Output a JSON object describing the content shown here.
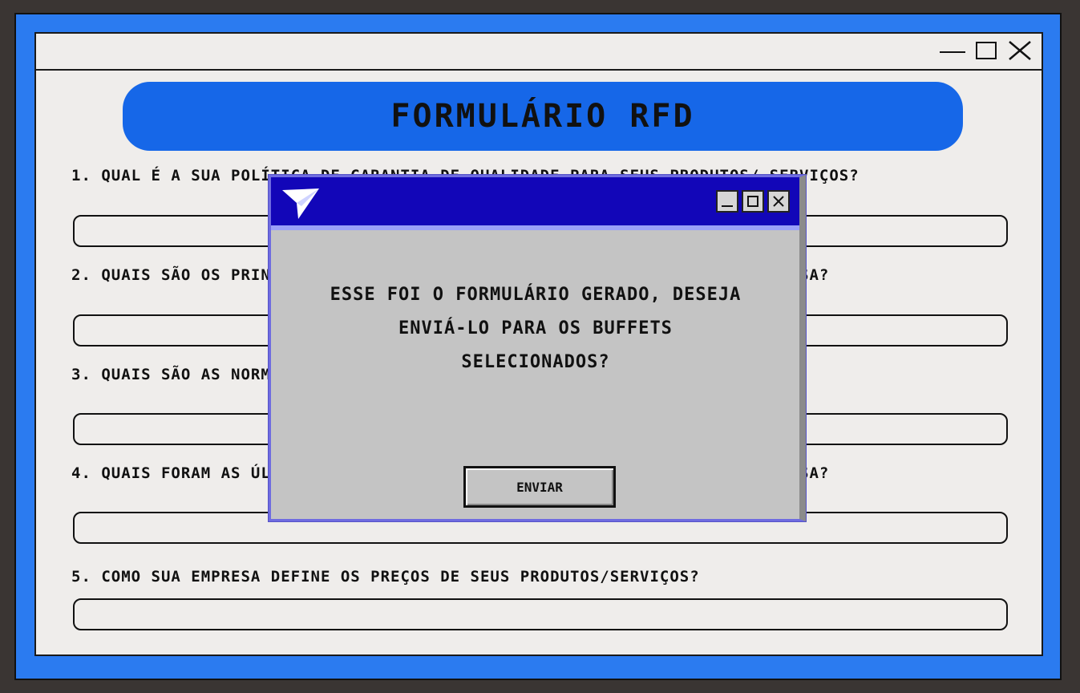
{
  "form": {
    "title": "FORMULÁRIO RFD",
    "questions": [
      {
        "label": "1. QUAL É A SUA POLÍTICA DE GARANTIA DE QUALIDADE PARA SEUS PRODUTOS/ SERVIÇOS?",
        "value": ""
      },
      {
        "label": "2. QUAIS SÃO OS PRINCIPAIS PRODUTOS OU SERVIÇOS OFERECIDOS PELA SUA EMPRESA?",
        "value": ""
      },
      {
        "label": "3. QUAIS SÃO AS NORMAS DE SEGURANÇA ADOTADAS EM SEUS PRODUTOS/SERVIÇOS?",
        "value": ""
      },
      {
        "label": "4. QUAIS FORAM AS ÚLTIMAS INOVAÇÕES NOS PRODUTOS OU SERVIÇOS DA SUA EMPRESA?",
        "value": ""
      },
      {
        "label": "5. COMO SUA EMPRESA DEFINE OS PREÇOS DE SEUS PRODUTOS/SERVIÇOS?",
        "value": ""
      }
    ]
  },
  "window_controls": {
    "minimize": "minimize-icon",
    "maximize": "maximize-icon",
    "close": "close-icon"
  },
  "modal": {
    "icon": "send-icon",
    "message": "ESSE FOI O FORMULÁRIO GERADO, DESEJA ENVIÁ-LO PARA OS BUFFETS SELECIONADOS?",
    "button_label": "ENVIAR"
  },
  "colors": {
    "outer_frame": "#2b7bf0",
    "banner": "#1667e8",
    "modal_titlebar": "#1206b8",
    "modal_body": "#c4c4c4",
    "window_bg": "#efedeb"
  }
}
